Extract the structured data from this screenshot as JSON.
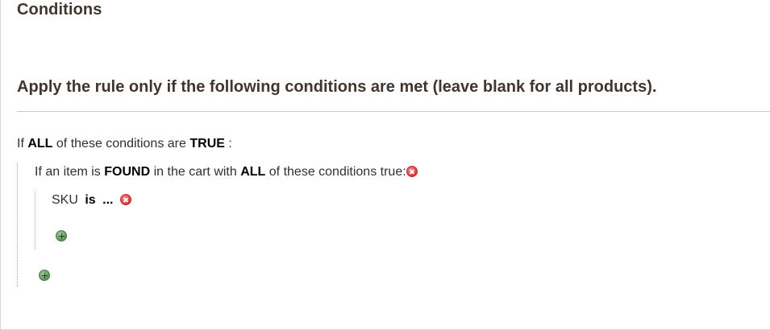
{
  "section": {
    "title": "Conditions"
  },
  "fieldset": {
    "legend": "Apply the rule only if the following conditions are met (leave blank for all products)."
  },
  "root_condition": {
    "prefix": "If",
    "aggregator": "ALL",
    "middle": "of these conditions are",
    "value": "TRUE",
    "suffix": ":"
  },
  "found_condition": {
    "prefix": "If an item is",
    "found_value": "FOUND",
    "middle": "in the cart with",
    "aggregator": "ALL",
    "suffix": "of these conditions true:"
  },
  "sku_condition": {
    "attribute": "SKU",
    "operator": "is",
    "value": "..."
  },
  "icons": {
    "remove": "remove-icon",
    "add": "add-icon"
  },
  "colors": {
    "remove_icon": "#e04848",
    "add_icon": "#6a9e66",
    "title_text": "#41362f"
  }
}
